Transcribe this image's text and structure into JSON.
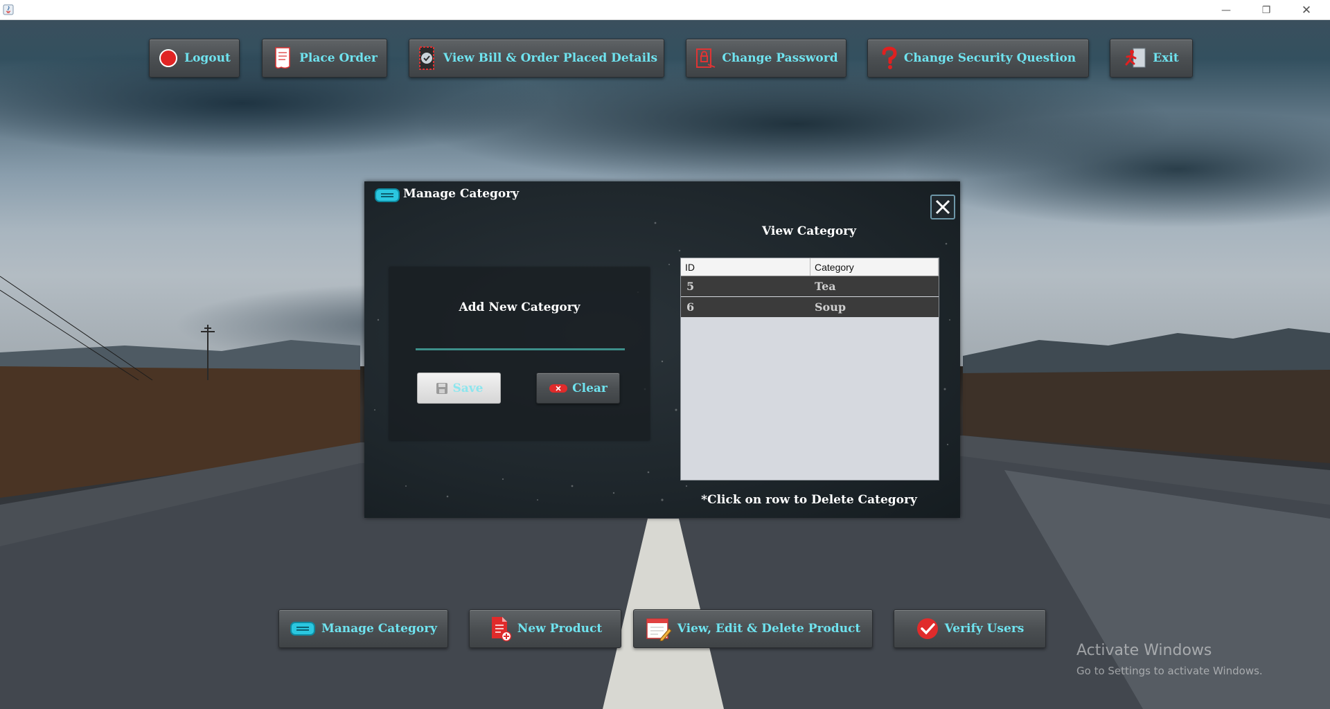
{
  "titlebar": {
    "minimize": "—",
    "maximize": "❐",
    "close": "✕"
  },
  "top_menu": {
    "logout": "Logout",
    "place_order": "Place Order",
    "view_bill": "View Bill & Order Placed Details",
    "change_password": "Change Password",
    "change_security": "Change Security Question",
    "exit": "Exit"
  },
  "bottom_menu": {
    "manage_category": "Manage Category",
    "new_product": "New Product",
    "view_edit_delete": "View, Edit & Delete Product",
    "verify_users": "Verify Users"
  },
  "dialog": {
    "title": "Manage Category",
    "add_title": "Add New Category",
    "input_value": "",
    "save_label": "Save",
    "clear_label": "Clear",
    "view_title": "View Category",
    "hint": "*Click on row to Delete Category",
    "table": {
      "columns": [
        "ID",
        "Category"
      ],
      "rows": [
        {
          "id": "5",
          "category": "Tea"
        },
        {
          "id": "6",
          "category": "Soup"
        }
      ]
    }
  },
  "watermark": {
    "line1": "Activate Windows",
    "line2": "Go to Settings to activate Windows."
  },
  "colors": {
    "button_text": "#6fe3ef",
    "input_underline": "#3d8f8a",
    "table_row_bg": "#3b3b3b"
  }
}
